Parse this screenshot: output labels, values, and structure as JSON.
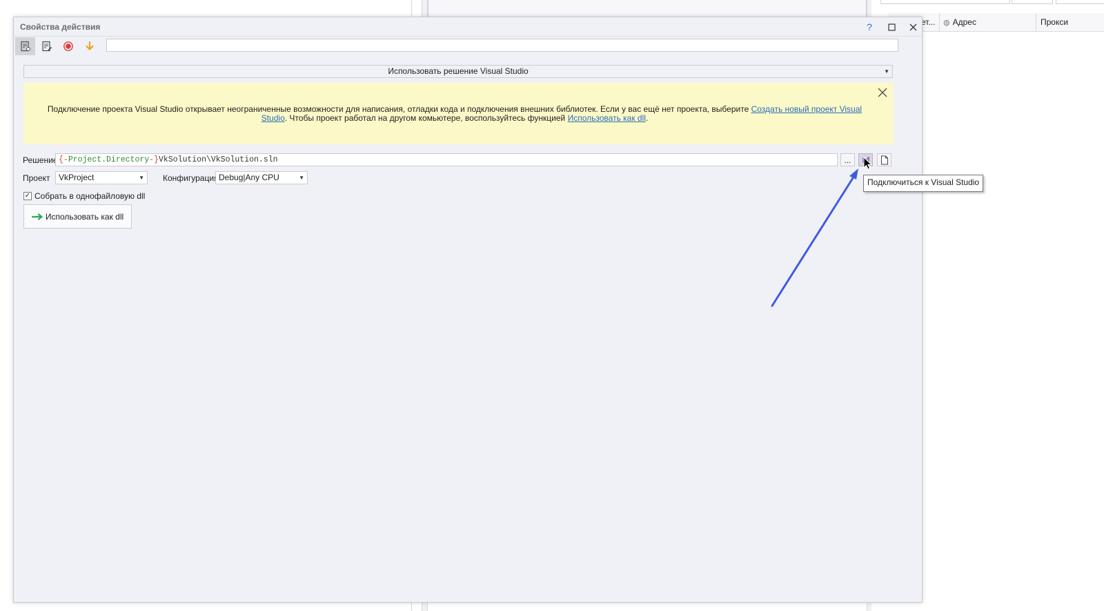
{
  "background": {
    "columns": {
      "methods": "Мет...",
      "address": "Адрес",
      "proxy": "Прокси"
    }
  },
  "dialog": {
    "title": "Свойства действия",
    "help": "?",
    "toolbar": {
      "search_value": ""
    },
    "mode_select": {
      "value": "Использовать решение Visual Studio"
    },
    "banner": {
      "text_before": "Подключение проекта Visual Studio открывает неограниченные возможности для написания, отладки кода и подключения внешних библиотек. Если у вас ещё нет проекта, выберите ",
      "link_create": "Создать новый проект Visual Studio",
      "text_middle": ". Чтобы проект работал на другом комьютере, воспользуйтесь функцией ",
      "link_dll": "Использовать как dll",
      "text_after": "."
    },
    "solution": {
      "label": "Решение",
      "brace_open": "{-",
      "var_project": "Project",
      "dot": ".",
      "var_directory": "Directory",
      "brace_close": "-}",
      "path_rest": "VkSolution\\VkSolution.sln",
      "browse_label": "..."
    },
    "project": {
      "label": "Проект",
      "value": "VkProject"
    },
    "configuration": {
      "label": "Конфигурация",
      "value": "Debug|Any CPU"
    },
    "single_file_dll": {
      "label": "Собрать в однофайловую dll",
      "checked": true,
      "check_mark": "✓"
    },
    "use_as_dll_button": {
      "label": "Использовать как dll"
    },
    "tooltip": "Подключиться к Visual Studio"
  },
  "colors": {
    "annotation_arrow": "#3f5be0",
    "banner_bg": "#fcf9c8",
    "link": "#2b6cb8",
    "record": "#e03b3b",
    "download": "#f0a020"
  }
}
